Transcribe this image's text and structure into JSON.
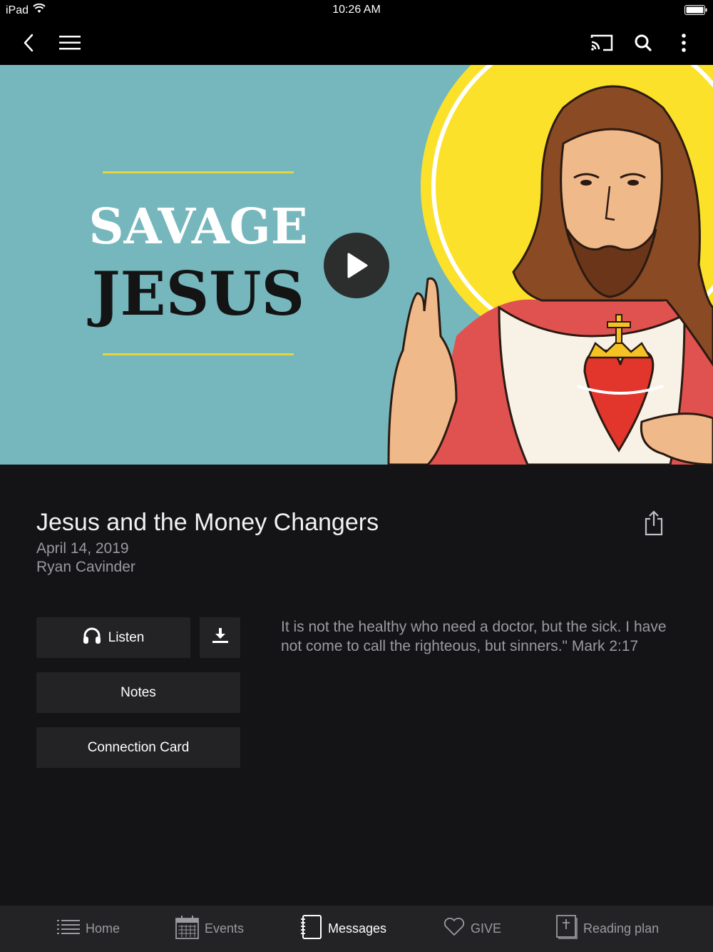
{
  "status_bar": {
    "device": "iPad",
    "time": "10:26 AM"
  },
  "hero": {
    "title_line1": "SAVAGE",
    "title_line2": "JESUS"
  },
  "sermon": {
    "title": "Jesus and the Money Changers",
    "date": "April 14, 2019",
    "speaker": "Ryan Cavinder",
    "quote": "It is not the healthy who need a doctor, but the sick. I have not come to call the righteous, but sinners.\"  Mark 2:17"
  },
  "actions": {
    "listen": "Listen",
    "notes": "Notes",
    "connection_card": "Connection Card"
  },
  "tabs": [
    {
      "label": "Home",
      "icon": "list-icon"
    },
    {
      "label": "Events",
      "icon": "calendar-icon"
    },
    {
      "label": "Messages",
      "icon": "notebook-icon",
      "active": true
    },
    {
      "label": "GIVE",
      "icon": "heart-icon"
    },
    {
      "label": "Reading plan",
      "icon": "bible-icon"
    }
  ],
  "colors": {
    "hero_bg": "#75b7bd",
    "accent_yellow": "#e8d53a",
    "tab_bg": "#232326",
    "content_bg": "#141417"
  }
}
